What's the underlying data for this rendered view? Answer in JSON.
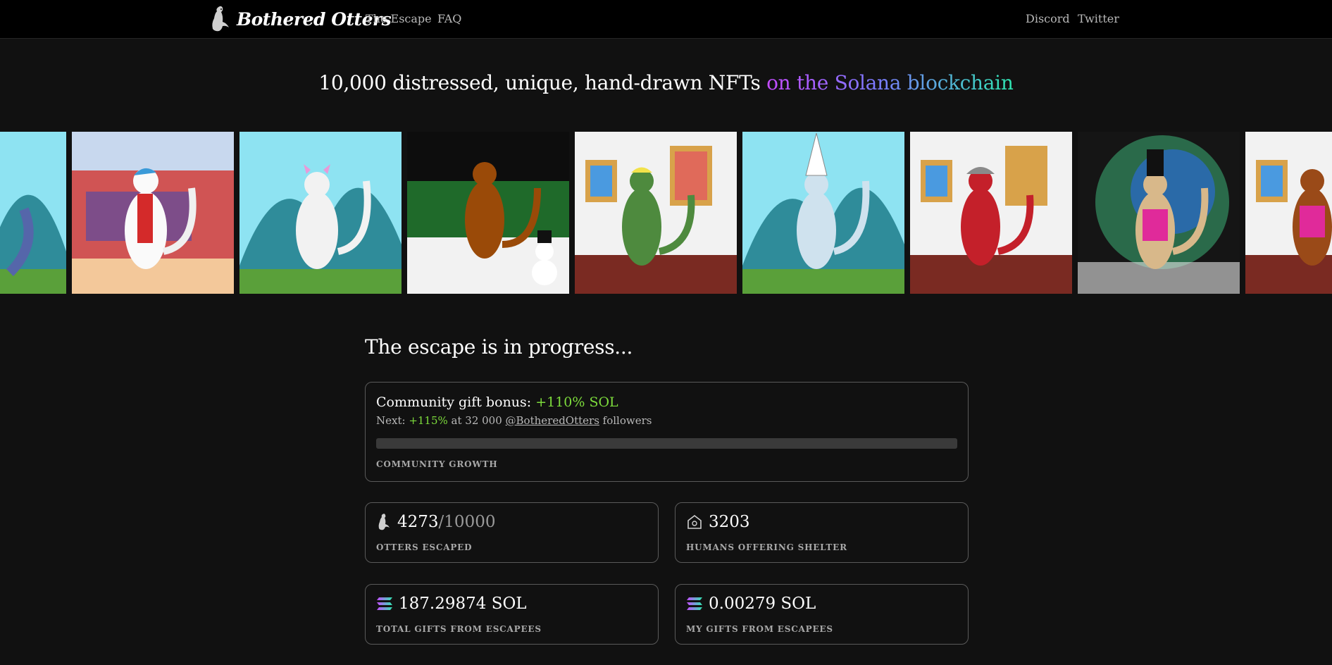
{
  "nav": {
    "brand": "Bothered Otters",
    "links": [
      "The Escape",
      "FAQ"
    ],
    "social": [
      "Discord",
      "Twitter"
    ]
  },
  "headline": {
    "main": "10,000 distressed, unique, hand-drawn NFTs ",
    "highlight": "on the Solana blockchain"
  },
  "colors": {
    "background": "#111111",
    "nav": "#000000",
    "green": "#7ddc3c",
    "gradient": [
      "#c54bff",
      "#7b7bff",
      "#2ee6b0"
    ]
  },
  "section_title": "The escape is in progress...",
  "gift": {
    "title_prefix": "Community gift bonus: ",
    "bonus": "+110% SOL",
    "next_prefix": "Next: ",
    "next_bonus": "+115%",
    "next_mid": " at 32 000 ",
    "handle": "@BotheredOtters",
    "next_suffix": " followers",
    "progress_fraction": 0,
    "caption": "COMMUNITY GROWTH"
  },
  "stats": [
    {
      "icon": "otter-icon",
      "value": "4273",
      "suffix": "/10000",
      "caption": "OTTERS ESCAPED"
    },
    {
      "icon": "house-icon",
      "value": "3203",
      "suffix": "",
      "caption": "HUMANS OFFERING SHELTER"
    },
    {
      "icon": "solana-icon",
      "value": "187.29874 SOL",
      "suffix": "",
      "caption": "TOTAL GIFTS FROM ESCAPEES"
    },
    {
      "icon": "solana-icon",
      "value": "0.00279 SOL",
      "suffix": "",
      "caption": "MY GIFTS FROM ESCAPEES"
    }
  ]
}
